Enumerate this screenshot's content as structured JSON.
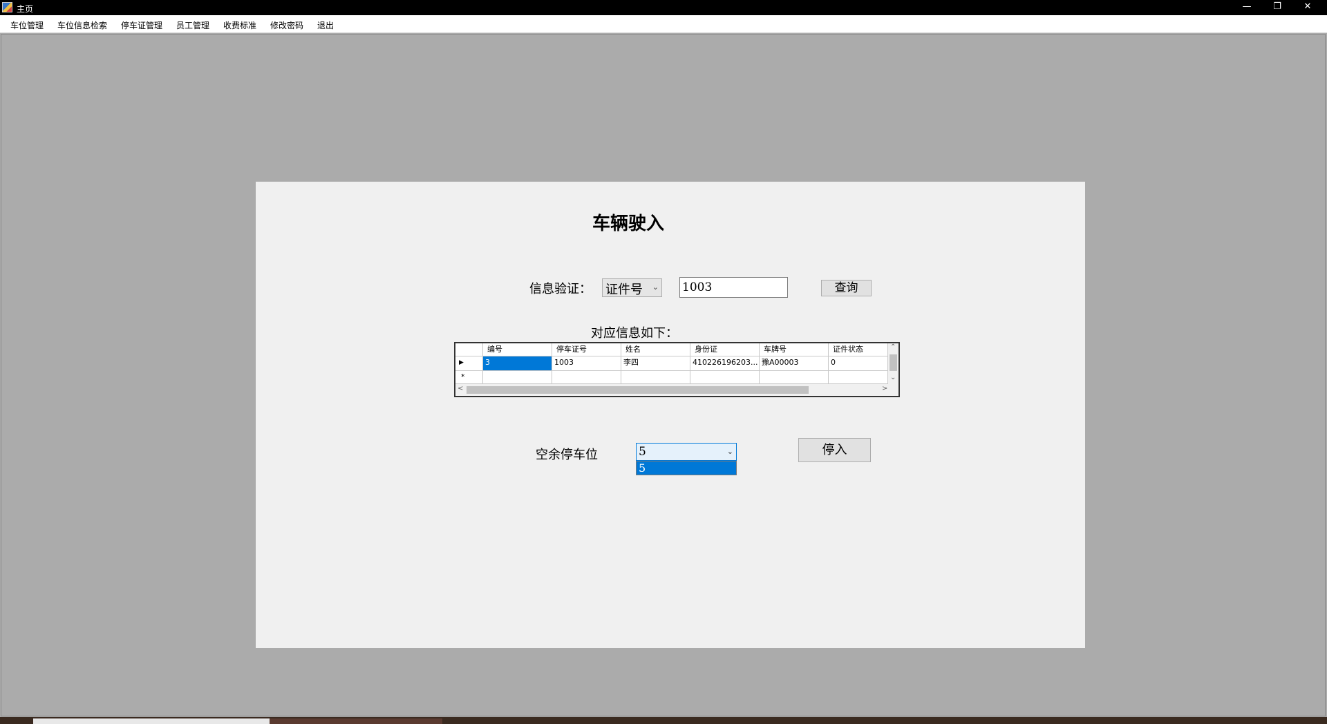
{
  "window": {
    "title": "主页",
    "minimize_glyph": "—",
    "restore_glyph": "❐",
    "close_glyph": "✕"
  },
  "menu": [
    {
      "label": "车位管理"
    },
    {
      "label": "车位信息检索"
    },
    {
      "label": "停车证管理"
    },
    {
      "label": "员工管理"
    },
    {
      "label": "收费标准"
    },
    {
      "label": "修改密码"
    },
    {
      "label": "退出"
    }
  ],
  "form": {
    "heading": "车辆驶入",
    "verify_label": "信息验证：",
    "verify_type": "证件号",
    "verify_value": "1003",
    "query_button": "查询",
    "result_label": "对应信息如下：",
    "spot_label": "空余停车位",
    "spot_selected": "5",
    "spot_options": [
      "5"
    ],
    "park_button": "停入"
  },
  "grid": {
    "columns": [
      "编号",
      "停车证号",
      "姓名",
      "身份证",
      "车牌号",
      "证件状态"
    ],
    "rows": [
      [
        "3",
        "1003",
        "李四",
        "410226196203...",
        "豫A00003",
        "0"
      ]
    ],
    "current_row_marker": "▶",
    "new_row_marker": "*"
  },
  "colors": {
    "selection": "#0078d7",
    "workspace": "#ababab",
    "panel": "#f0f0f0"
  }
}
